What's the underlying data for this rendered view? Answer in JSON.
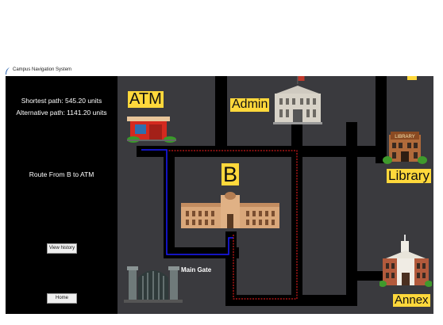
{
  "window": {
    "title": "Campus Navigation System"
  },
  "sidebar": {
    "shortest": "Shortest path: 545.20 units",
    "alternative": "Alternative path: 1141.20 units",
    "route": "Route From B to ATM",
    "history_button": "View history",
    "home_button": "Home"
  },
  "map": {
    "buildings": {
      "atm": "ATM",
      "admin": "Admin",
      "b": "B",
      "library": "Library",
      "main_gate": "Main Gate",
      "annex": "Annex",
      "library_sign": "LIBRARY"
    }
  },
  "colors": {
    "map_bg": "#3a3a3e",
    "road": "#000000",
    "label_bg": "#ffd83b",
    "shortest_path": "#1a1aff",
    "alternative_path": "#ff2020"
  }
}
